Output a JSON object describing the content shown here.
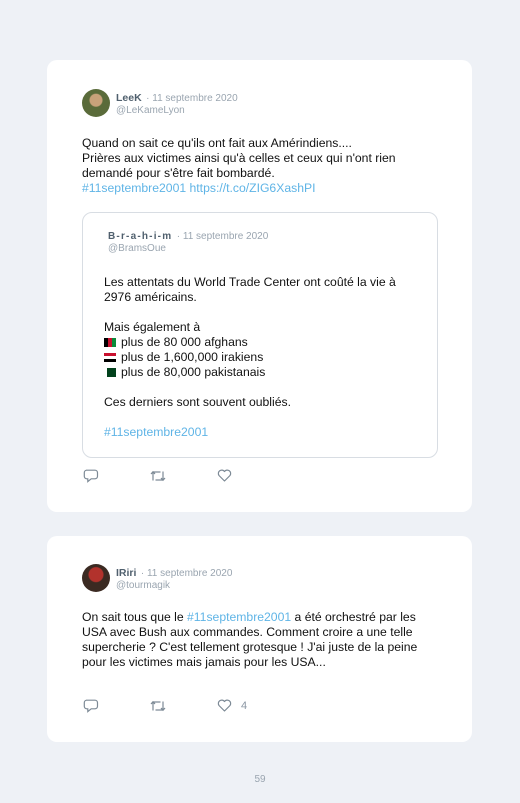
{
  "tweet1": {
    "author": "LeeK",
    "date": "· 11 septembre 2020",
    "handle": "@LeKameLyon",
    "line1": "Quand on sait ce qu'ils ont fait aux Amérindiens....",
    "line2": "Prières aux victimes ainsi qu'à celles et ceux qui n'ont rien demandé pour s'être fait bombardé.",
    "hashtag": "#11septembre2001",
    "url": "https://t.co/ZIG6XashPI",
    "quote": {
      "author": "B-r-a-h-i-m",
      "date": "· 11 septembre 2020",
      "handle": "@BramsOue",
      "line1": "Les attentats du World Trade Center ont coûté la vie à 2976 américains.",
      "line2": "Mais également à",
      "item1": "plus de 80 000 afghans",
      "item2": "plus de 1,600,000 irakiens",
      "item3": "plus de 80,000 pakistanais",
      "line3": "Ces derniers sont souvent oubliés.",
      "hashtag": "#11septembre2001"
    }
  },
  "tweet2": {
    "author": "IRiri",
    "date": "· 11 septembre 2020",
    "handle": "@tourmagik",
    "text_before": "On sait tous que le ",
    "hashtag": "#11septembre2001",
    "text_after": " a été orchestré par les USA avec Bush aux commandes. Comment croire a une telle supercherie ? C'est tellement grotesque ! J'ai juste de la peine pour les victimes mais jamais pour les USA...",
    "like_count": "4"
  },
  "icons": [
    "reply-icon",
    "retweet-icon",
    "like-icon"
  ],
  "page_number": "59"
}
